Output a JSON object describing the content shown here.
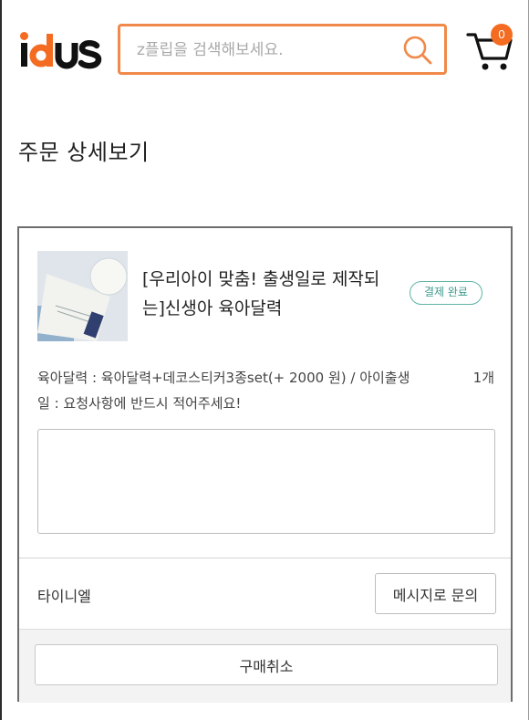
{
  "header": {
    "logo": "idus",
    "search": {
      "placeholder": "z플립을 검색해보세요.",
      "value": ""
    },
    "cart": {
      "count": "0"
    }
  },
  "page": {
    "title": "주문 상세보기"
  },
  "order": {
    "product_title": "[우리아이 맞춤! 출생일로 제작되는]신생아 육아달력",
    "status": "결제 완료",
    "option": "육아달력 : 육아달력+데코스티커3종set(+ 2000 원) / 아이출생일 : 요청사항에 반드시 적어주세요!",
    "quantity": "1개",
    "memo": {
      "value": "",
      "placeholder": ""
    },
    "seller": "타이니엘",
    "message_button": "메시지로 문의",
    "cancel_button": "구매취소"
  },
  "colors": {
    "accent": "#f36c21",
    "search_border": "#f0894a",
    "status": "#3c9a8b"
  },
  "icons": [
    "search-icon",
    "cart-icon"
  ]
}
